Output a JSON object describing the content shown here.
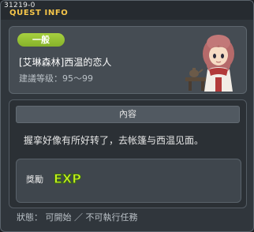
{
  "window": {
    "id": "31219-0",
    "title": "QUEST INFO"
  },
  "quest": {
    "category_badge": "一般",
    "name": "[艾琳森林]西温的恋人",
    "level_range": "建議等级：95～99",
    "npc_portrait": "npc-girl-portrait"
  },
  "content": {
    "header": "內容",
    "text": "握挛好像有所好转了，去帐篷与西温见面。"
  },
  "reward": {
    "label": "獎勵",
    "icon_text": "EXP"
  },
  "status": {
    "text": "狀態： 可開始 ／ 不可執行任務"
  },
  "colors": {
    "badge": "#9ac43a",
    "title": "#f6c64a",
    "exp": "#c8f020"
  }
}
